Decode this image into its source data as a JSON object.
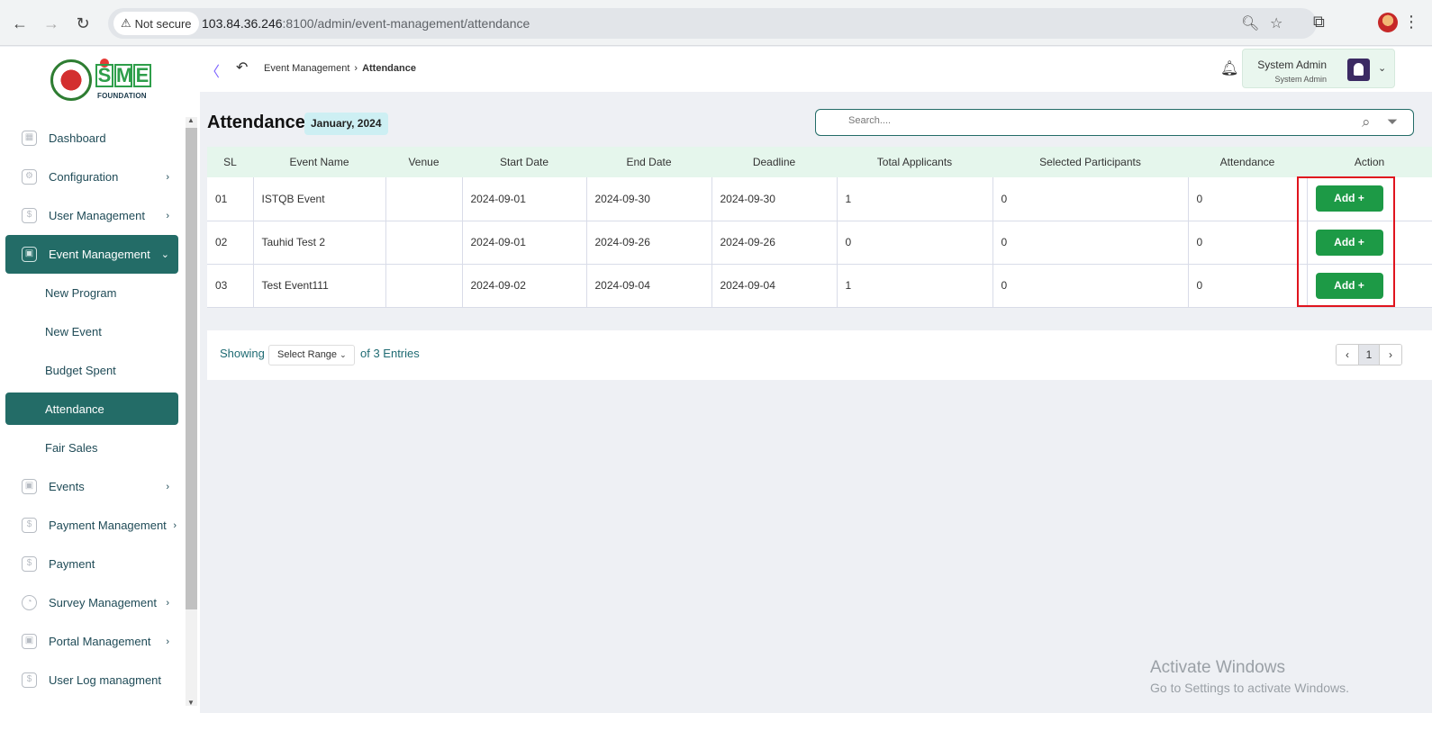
{
  "browser": {
    "security_label": "Not secure",
    "url_host": "103.84.36.246",
    "url_rest": ":8100/admin/event-management/attendance"
  },
  "brand": {
    "letters": [
      "S",
      "M",
      "E"
    ],
    "subtitle": "FOUNDATION",
    "accent": "#236c67",
    "button_green": "#1d9a46"
  },
  "sidebar": {
    "items": [
      {
        "label": "Dashboard",
        "icon": "grid-icon",
        "has_children": false
      },
      {
        "label": "Configuration",
        "icon": "config-icon",
        "has_children": true
      },
      {
        "label": "User Management",
        "icon": "shield-icon",
        "has_children": true
      },
      {
        "label": "Event Management",
        "icon": "lock-icon",
        "has_children": true,
        "expanded": true,
        "children": [
          "New Program",
          "New Event",
          "Budget Spent",
          "Attendance",
          "Fair Sales"
        ],
        "active_child": "Attendance"
      },
      {
        "label": "Events",
        "icon": "lock-icon",
        "has_children": true
      },
      {
        "label": "Payment Management",
        "icon": "money-icon",
        "has_children": true
      },
      {
        "label": "Payment",
        "icon": "money-icon",
        "has_children": false
      },
      {
        "label": "Survey Management",
        "icon": "pie-chart-icon",
        "has_children": true
      },
      {
        "label": "Portal Management",
        "icon": "lock-icon",
        "has_children": true
      },
      {
        "label": "User Log managment",
        "icon": "money-icon",
        "has_children": false
      }
    ]
  },
  "header": {
    "breadcrumb_parent": "Event Management",
    "breadcrumb_current": "Attendance",
    "user_name": "System Admin",
    "user_role": "System Admin"
  },
  "page": {
    "title": "Attendance",
    "month_badge": "January, 2024",
    "search_placeholder": "Search....",
    "columns": [
      "SL",
      "Event Name",
      "Venue",
      "Start Date",
      "End Date",
      "Deadline",
      "Total Applicants",
      "Selected Participants",
      "Attendance",
      "Action"
    ],
    "rows": [
      {
        "sl": "01",
        "event_name": "ISTQB Event",
        "venue": "",
        "start_date": "2024-09-01",
        "end_date": "2024-09-30",
        "deadline": "2024-09-30",
        "total_applicants": "1",
        "selected_participants": "0",
        "attendance": "0",
        "action": "Add +"
      },
      {
        "sl": "02",
        "event_name": "Tauhid Test 2",
        "venue": "",
        "start_date": "2024-09-01",
        "end_date": "2024-09-26",
        "deadline": "2024-09-26",
        "total_applicants": "0",
        "selected_participants": "0",
        "attendance": "0",
        "action": "Add +"
      },
      {
        "sl": "03",
        "event_name": "Test Event111",
        "venue": "",
        "start_date": "2024-09-02",
        "end_date": "2024-09-04",
        "deadline": "2024-09-04",
        "total_applicants": "1",
        "selected_participants": "0",
        "attendance": "0",
        "action": "Add +"
      }
    ]
  },
  "pagination": {
    "showing_label": "Showing",
    "range_select": "Select Range",
    "entries_label": "of 3 Entries",
    "current_page": "1"
  },
  "watermark": {
    "line1": "Activate Windows",
    "line2": "Go to Settings to activate Windows."
  }
}
